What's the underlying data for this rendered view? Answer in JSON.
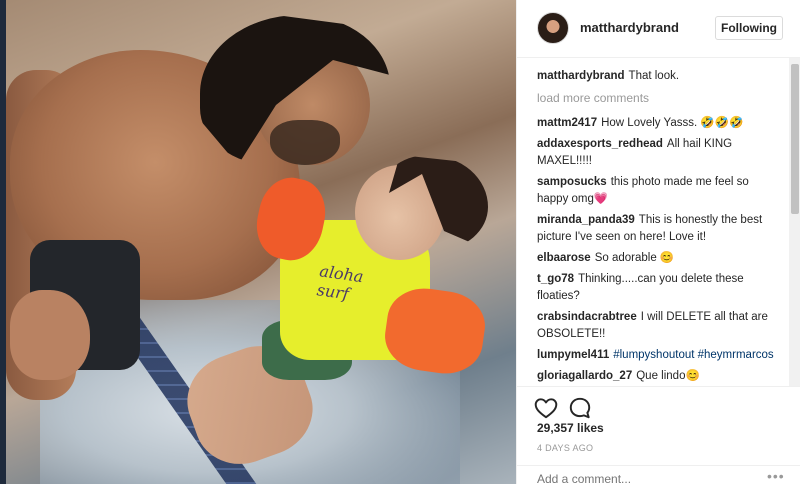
{
  "post": {
    "username": "matthardybrand",
    "follow_button": "Following",
    "caption": {
      "user": "matthardybrand",
      "text": "That look."
    },
    "load_more": "load more comments",
    "comments": [
      {
        "user": "mattm2417",
        "text": "How Lovely Yasss. 🤣🤣🤣"
      },
      {
        "user": "addaxesports_redhead",
        "text": "All hail KING MAXEL!!!!!"
      },
      {
        "user": "samposucks",
        "text": "this photo made me feel so happy omg💗"
      },
      {
        "user": "miranda_panda39",
        "text": "This is honestly the best picture I've seen on here! Love it!"
      },
      {
        "user": "elbaarose",
        "text": "So adorable 😊"
      },
      {
        "user": "t_go78",
        "text": "Thinking.....can you delete these floaties?"
      },
      {
        "user": "crabsindacrabtree",
        "text": "I will DELETE all that are OBSOLETE!!"
      },
      {
        "user": "lumpymel411",
        "tags": "#lumpyshoutout #heymrmarcos"
      },
      {
        "user": "gloriagallardo_27",
        "text": "Que lindo😊"
      }
    ],
    "likes": "29,357 likes",
    "timestamp": "4 DAYS AGO",
    "add_comment_placeholder": "Add a comment...",
    "more_dots": "•••",
    "shirt_text": "aloha surf",
    "icons": {
      "like": "heart-icon",
      "comment": "comment-bubble-icon",
      "options": "more-options-icon"
    }
  }
}
